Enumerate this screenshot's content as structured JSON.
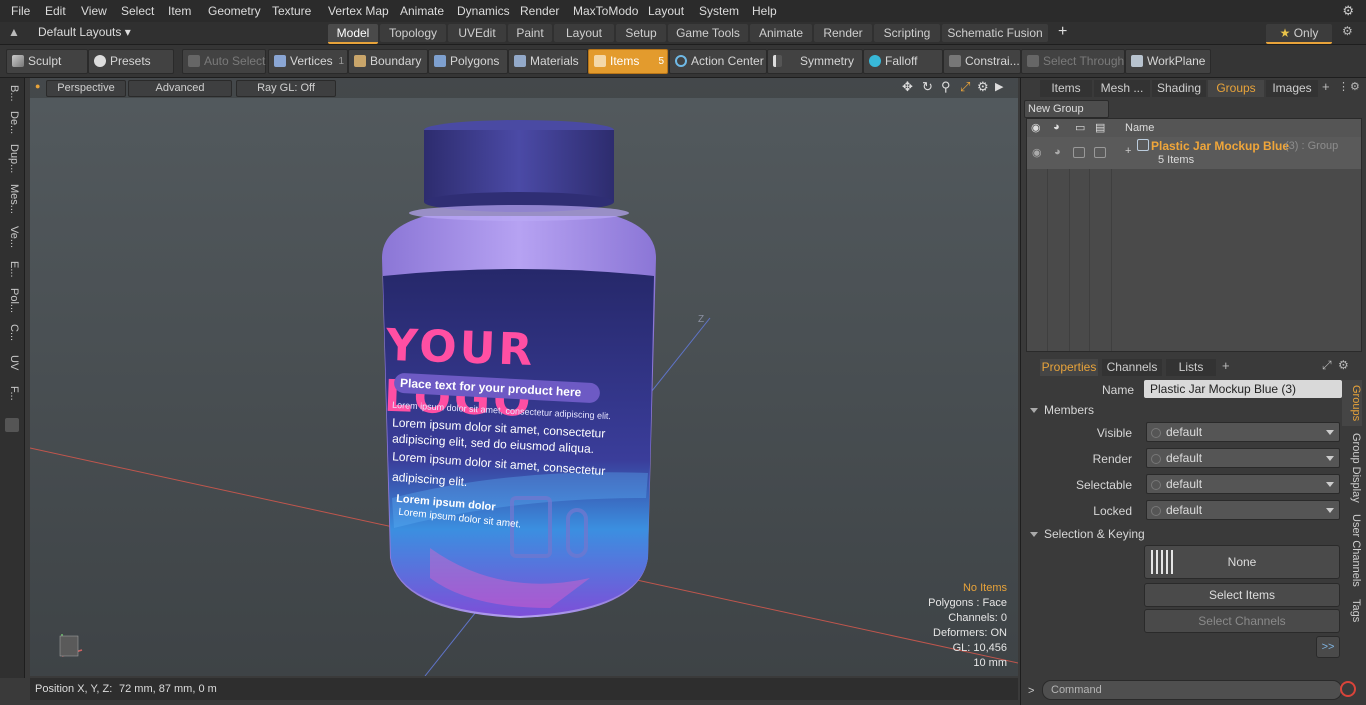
{
  "menu": [
    "File",
    "Edit",
    "View",
    "Select",
    "Item",
    "Geometry",
    "Texture",
    "Vertex Map",
    "Animate",
    "Dynamics",
    "Render",
    "MaxToModo",
    "Layout",
    "System",
    "Help"
  ],
  "layout_dropdown": "Default Layouts",
  "layout_tabs": [
    "Model",
    "Topology",
    "UVEdit",
    "Paint",
    "Layout",
    "Setup",
    "Game Tools",
    "Animate",
    "Render",
    "Scripting",
    "Schematic Fusion"
  ],
  "only_label": "Only",
  "toolbar": {
    "sculpt": "Sculpt",
    "presets": "Presets",
    "auto_select": "Auto Select",
    "vertices": "Vertices",
    "vertices_count": "1",
    "boundary": "Boundary",
    "polygons": "Polygons",
    "materials": "Materials",
    "items": "Items",
    "items_count": "5",
    "action_center": "Action Center",
    "symmetry": "Symmetry",
    "falloff": "Falloff",
    "constraints": "Constrai...",
    "select_through": "Select Through",
    "workplane": "WorkPlane"
  },
  "left_tabs": [
    "B...",
    "De...",
    "Dup...",
    "Mes...",
    "Ve...",
    "E...",
    "Pol...",
    "C...",
    "UV",
    "F..."
  ],
  "viewport": {
    "perspective": "Perspective",
    "advanced": "Advanced",
    "raygl": "Ray GL: Off",
    "label_logo": "YOUR LOGO",
    "label_tagline": "Place text for your product here",
    "label_body1": "Lorem ipsum dolor sit amet, consectetur adipiscing elit.",
    "label_body2": "Lorem ipsum dolor sit amet, consectetur",
    "label_body3": "adipiscing elit, sed do eiusmod aliqua.",
    "label_body4": "Lorem ipsum dolor sit amet, consectetur",
    "label_body5": "adipiscing elit.",
    "label_body6": "Lorem ipsum dolor",
    "label_body7": "Lorem ipsum dolor sit amet.",
    "axis_label": "Z",
    "stats": {
      "no_items": "No Items",
      "polygons": "Polygons : Face",
      "channels": "Channels: 0",
      "deformers": "Deformers: ON",
      "gl": "GL: 10,456",
      "scale": "10 mm"
    }
  },
  "status": {
    "position_label": "Position X, Y, Z:",
    "position_value": "72 mm, 87 mm, 0 m"
  },
  "top_panel": {
    "tabs": [
      "Items",
      "Mesh ...",
      "Shading",
      "Groups",
      "Images"
    ],
    "active_tab": "Groups",
    "new_group": "New Group",
    "col_name": "Name",
    "group_name": "Plastic Jar Mockup Blue",
    "group_suffix": "(3) : Group",
    "group_items": "5 Items"
  },
  "props_panel": {
    "tabs": [
      "Properties",
      "Channels",
      "Lists"
    ],
    "name_label": "Name",
    "name_value": "Plastic Jar Mockup Blue (3)",
    "members": "Members",
    "rows": [
      {
        "label": "Visible",
        "value": "default"
      },
      {
        "label": "Render",
        "value": "default"
      },
      {
        "label": "Selectable",
        "value": "default"
      },
      {
        "label": "Locked",
        "value": "default"
      }
    ],
    "selection_keying": "Selection & Keying",
    "none": "None",
    "select_items": "Select Items",
    "select_channels": "Select Channels",
    "more": ">>",
    "side_tabs": [
      "Groups",
      "Group Display",
      "User Channels",
      "Tags"
    ]
  },
  "command_placeholder": "Command",
  "colors": {
    "accent": "#e8a33a",
    "jar_cap": "#3d3c8c",
    "jar_body": "#9a84e6",
    "label_dark": "#2a2b6a",
    "logo_pink": "#ff4fa3"
  }
}
